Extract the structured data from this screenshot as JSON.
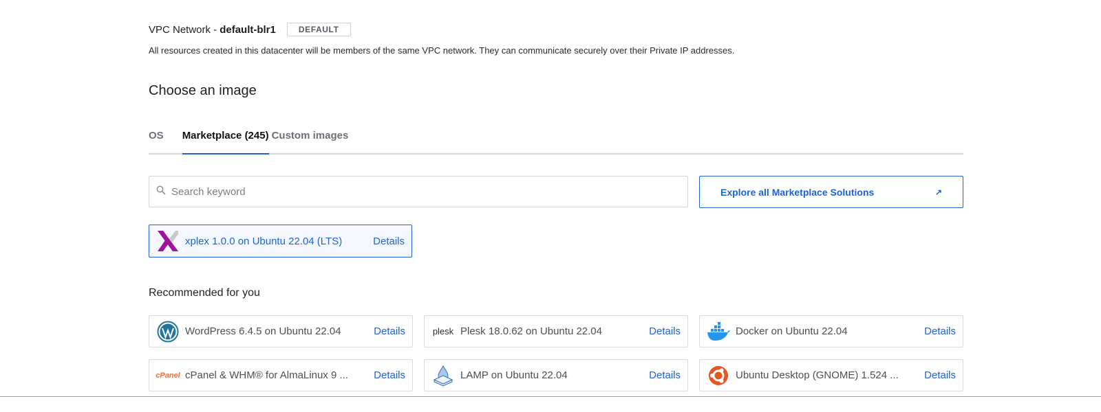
{
  "vpc": {
    "prefix": "VPC Network - ",
    "name": "default-blr1",
    "badge": "DEFAULT",
    "description": "All resources created in this datacenter will be members of the same VPC network. They can communicate securely over their Private IP addresses."
  },
  "section_title": "Choose an image",
  "tabs": [
    {
      "label": "OS",
      "active": false
    },
    {
      "label": "Marketplace (245)",
      "active": true
    },
    {
      "label": "Custom images",
      "active": false
    }
  ],
  "search": {
    "placeholder": "Search keyword",
    "value": ""
  },
  "explore": {
    "label": "Explore all Marketplace Solutions",
    "arrow": "↗"
  },
  "selected": {
    "name": "xplex 1.0.0 on Ubuntu 22.04 (LTS)",
    "details": "Details",
    "icon": "xplex-logo-icon"
  },
  "recommended_title": "Recommended for you",
  "recommended": [
    {
      "name": "WordPress 6.4.5 on Ubuntu 22.04",
      "details": "Details",
      "icon": "wordpress-logo-icon"
    },
    {
      "name": "Plesk 18.0.62 on Ubuntu 22.04",
      "details": "Details",
      "icon": "plesk-logo-icon",
      "logo_text": "plesk"
    },
    {
      "name": "Docker on Ubuntu 22.04",
      "details": "Details",
      "icon": "docker-logo-icon"
    },
    {
      "name": "cPanel & WHM® for AlmaLinux 9 ...",
      "details": "Details",
      "icon": "cpanel-logo-icon",
      "logo_text": "cPanel"
    },
    {
      "name": "LAMP on Ubuntu 22.04",
      "details": "Details",
      "icon": "lamp-logo-icon"
    },
    {
      "name": "Ubuntu Desktop (GNOME) 1.524 ...",
      "details": "Details",
      "icon": "ubuntu-logo-icon"
    }
  ],
  "colors": {
    "accent": "#1d63d6",
    "xplex": "#a0139d",
    "wordpress": "#21759b",
    "docker": "#2496ed",
    "cpanel": "#ff6c2c",
    "ubuntu": "#e95420"
  }
}
